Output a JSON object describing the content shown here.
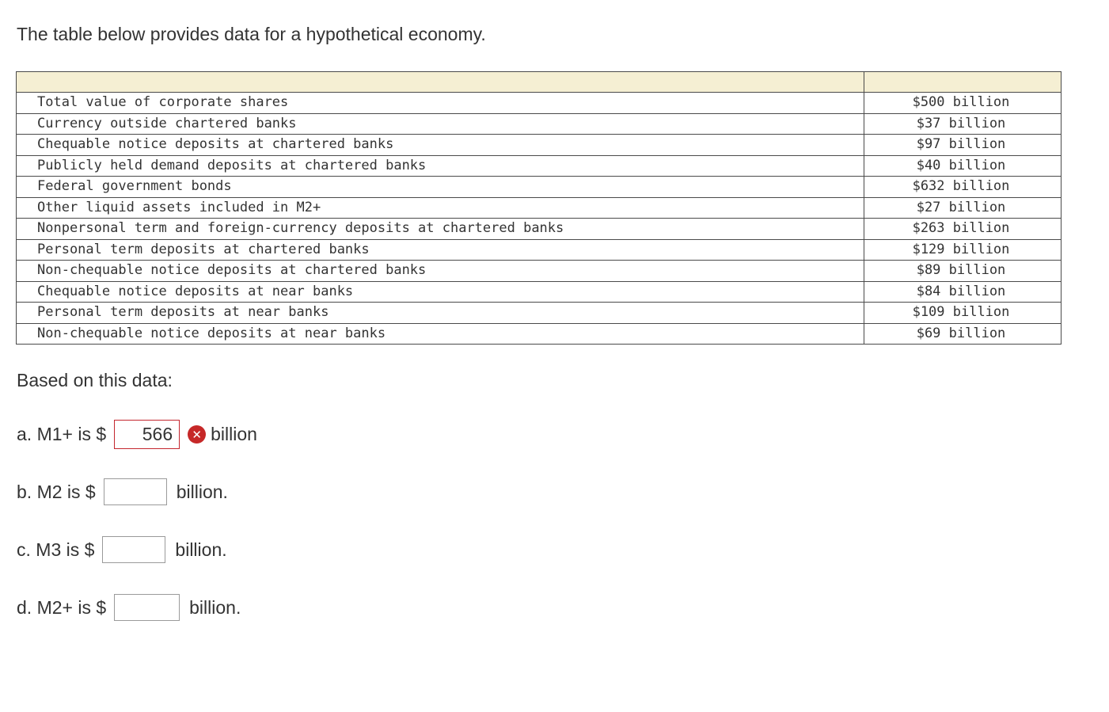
{
  "intro": "The table below provides data for a hypothetical economy.",
  "table": {
    "rows": [
      {
        "label": "Total value of corporate shares",
        "value": "$500 billion"
      },
      {
        "label": "Currency outside chartered banks",
        "value": "$37 billion"
      },
      {
        "label": "Chequable notice deposits at chartered banks",
        "value": "$97 billion"
      },
      {
        "label": "Publicly held demand deposits at chartered banks",
        "value": "$40 billion"
      },
      {
        "label": "Federal government bonds",
        "value": "$632 billion"
      },
      {
        "label": "Other liquid assets included in M2+",
        "value": "$27 billion"
      },
      {
        "label": "Nonpersonal term and foreign-currency deposits at chartered banks",
        "value": "$263 billion"
      },
      {
        "label": "Personal term deposits at chartered banks",
        "value": "$129 billion"
      },
      {
        "label": "Non-chequable notice deposits at chartered banks",
        "value": "$89 billion"
      },
      {
        "label": "Chequable notice deposits at near banks",
        "value": "$84 billion"
      },
      {
        "label": "Personal term deposits at near banks",
        "value": "$109 billion"
      },
      {
        "label": "Non-chequable notice deposits at near banks",
        "value": "$69 billion"
      }
    ]
  },
  "based_on": "Based on this data:",
  "questions": {
    "a": {
      "prefix": "a. M1+ is $",
      "value": "566",
      "suffix": "billion",
      "status": "incorrect"
    },
    "b": {
      "prefix": "b. M2 is $",
      "value": "",
      "suffix": "billion."
    },
    "c": {
      "prefix": "c. M3 is $",
      "value": "",
      "suffix": "billion."
    },
    "d": {
      "prefix": "d. M2+ is $",
      "value": "",
      "suffix": "billion."
    }
  },
  "colors": {
    "header_fill": "#f5efd3",
    "error_red": "#c62828"
  },
  "icons": {
    "incorrect": "x-circle-icon"
  }
}
